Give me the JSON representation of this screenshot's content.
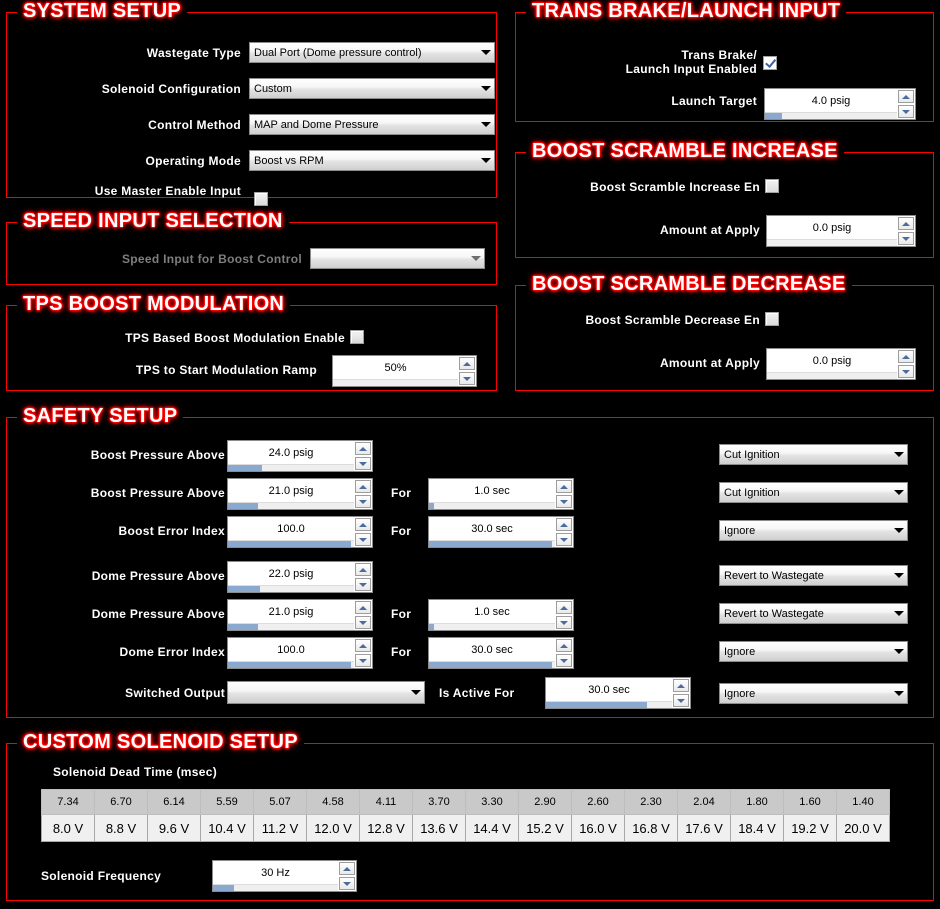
{
  "sections": {
    "system_setup": {
      "title": "SYSTEM SETUP",
      "rows": [
        {
          "label": "Wastegate Type",
          "value": "Dual Port (Dome pressure control)"
        },
        {
          "label": "Solenoid Configuration",
          "value": "Custom"
        },
        {
          "label": "Control Method",
          "value": "MAP and Dome Pressure"
        },
        {
          "label": "Operating Mode",
          "value": "Boost vs RPM"
        }
      ],
      "master_enable_label": "Use Master Enable Input",
      "master_enable_checked": false
    },
    "speed_input": {
      "title": "SPEED INPUT SELECTION",
      "label": "Speed Input for Boost Control",
      "value": ""
    },
    "tps": {
      "title": "TPS BOOST MODULATION",
      "enable_label": "TPS Based Boost Modulation Enable",
      "enable_checked": false,
      "ramp_label": "TPS to Start Modulation Ramp",
      "ramp_value": "50%"
    },
    "trans_brake": {
      "title": "TRANS BRAKE/LAUNCH INPUT",
      "enable_label_line1": "Trans Brake/",
      "enable_label_line2": "Launch Input Enabled",
      "enable_checked": true,
      "target_label": "Launch Target",
      "target_value": "4.0 psig"
    },
    "scramble_increase": {
      "title": "BOOST SCRAMBLE INCREASE",
      "enable_label": "Boost Scramble Increase En",
      "enable_checked": false,
      "amount_label": "Amount at Apply",
      "amount_value": "0.0 psig"
    },
    "scramble_decrease": {
      "title": "BOOST SCRAMBLE DECREASE",
      "enable_label": "Boost Scramble Decrease En",
      "enable_checked": false,
      "amount_label": "Amount at Apply",
      "amount_value": "0.0 psig"
    },
    "safety": {
      "title": "SAFETY SETUP",
      "for_label": "For",
      "is_active_for_label": "Is Active For",
      "switched_output_label": "Switched Output",
      "switched_output_value": "",
      "switched_active_value": "30.0 sec",
      "switched_action": "Ignore",
      "rows": [
        {
          "label": "Boost Pressure Above",
          "value": "24.0 psig",
          "for_value": "",
          "action": "Cut Ignition"
        },
        {
          "label": "Boost Pressure Above",
          "value": "21.0 psig",
          "for_value": "1.0 sec",
          "action": "Cut Ignition"
        },
        {
          "label": "Boost Error Index",
          "value": "100.0",
          "for_value": "30.0 sec",
          "action": "Ignore"
        },
        {
          "label": "Dome Pressure Above",
          "value": "22.0 psig",
          "for_value": "",
          "action": "Revert to Wastegate"
        },
        {
          "label": "Dome Pressure Above",
          "value": "21.0 psig",
          "for_value": "1.0 sec",
          "action": "Revert to Wastegate"
        },
        {
          "label": "Dome Error Index",
          "value": "100.0",
          "for_value": "30.0 sec",
          "action": "Ignore"
        }
      ]
    },
    "solenoid": {
      "title": "CUSTOM SOLENOID SETUP",
      "table_label": "Solenoid Dead Time (msec)",
      "dead_time": [
        "7.34",
        "6.70",
        "6.14",
        "5.59",
        "5.07",
        "4.58",
        "4.11",
        "3.70",
        "3.30",
        "2.90",
        "2.60",
        "2.30",
        "2.04",
        "1.80",
        "1.60",
        "1.40"
      ],
      "voltage": [
        "8.0 V",
        "8.8 V",
        "9.6 V",
        "10.4 V",
        "11.2 V",
        "12.0 V",
        "12.8 V",
        "13.6 V",
        "14.4 V",
        "15.2 V",
        "16.0 V",
        "16.8 V",
        "17.6 V",
        "18.4 V",
        "19.2 V",
        "20.0 V"
      ],
      "frequency_label": "Solenoid Frequency",
      "frequency_value": "30 Hz"
    }
  },
  "colors": {
    "background": "#000000",
    "section_border": "#ff0000",
    "legend_glow": "#ff0000",
    "legend_text": "#ffffff",
    "label_text": "#ffffff",
    "label_disabled": "#7e7e7e",
    "progress_fill": "#8ba9ce",
    "check_mark": "#3f62a0"
  },
  "fills": {
    "launch_target": 13,
    "scramble_inc": 0,
    "scramble_dec": 0,
    "tps_ramp": 0,
    "boost_above_1": 27,
    "boost_above_2": 24,
    "boost_err_idx": 98,
    "dome_above_1": 25,
    "dome_above_2": 24,
    "dome_err_idx": 98,
    "for_1": 4,
    "for_2": 98,
    "for_3": 4,
    "for_4": 98,
    "switched_active": 80,
    "solenoid_freq": 17
  }
}
